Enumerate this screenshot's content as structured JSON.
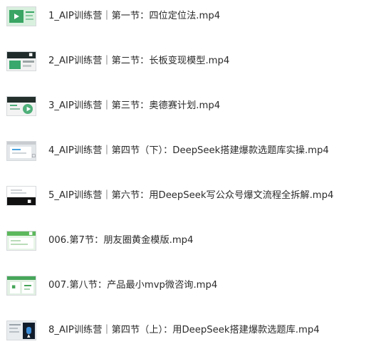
{
  "files": [
    {
      "name": "1_AIP训练营｜第一节：四位定位法.mp4",
      "thumbnail": {
        "style": "green-title-slide",
        "colors": [
          "#3aa564",
          "#ffffff",
          "#d9f0df"
        ],
        "icon": "play-icon"
      }
    },
    {
      "name": "2_AIP训练营｜第二节：长板变现模型.mp4",
      "thumbnail": {
        "style": "dark-header-slide",
        "colors": [
          "#1f2a2a",
          "#38a86c",
          "#f2f2f2"
        ],
        "icon": "slide-icon"
      }
    },
    {
      "name": "3_AIP训练营｜第三节：奥德赛计划.mp4",
      "thumbnail": {
        "style": "dark-header-slide",
        "colors": [
          "#23302c",
          "#4fb07a",
          "#f3f3f3"
        ],
        "icon": "slide-icon"
      }
    },
    {
      "name": "4_AIP训练营｜第四节（下）：DeepSeek搭建爆款选题库实操.mp4",
      "thumbnail": {
        "style": "light-screen",
        "colors": [
          "#e4e7ea",
          "#ffffff",
          "#4aa3df"
        ],
        "icon": "screen-icon"
      }
    },
    {
      "name": "5_AIP训练营｜第六节：用DeepSeek写公众号爆文流程全拆解.mp4",
      "thumbnail": {
        "style": "split-dark-screen",
        "colors": [
          "#ffffff",
          "#111111",
          "#cfd3d6"
        ],
        "icon": "screen-icon"
      }
    },
    {
      "name": "006.第7节：朋友圈黄金模版.mp4",
      "thumbnail": {
        "style": "green-sheet",
        "colors": [
          "#5cb85c",
          "#ffffff",
          "#e8f5e8"
        ],
        "icon": "sheet-icon"
      }
    },
    {
      "name": "007.第八节：产品最小mvp微咨询.mp4",
      "thumbnail": {
        "style": "green-sheet",
        "colors": [
          "#46a65a",
          "#ffffff",
          "#e2f1e4"
        ],
        "icon": "sheet-icon"
      }
    },
    {
      "name": "8_AIP训练营｜第四节（上）：用DeepSeek搭建爆款选题库.mp4",
      "thumbnail": {
        "style": "dark-photo-slide",
        "colors": [
          "#e9ecef",
          "#111c2b",
          "#3c8dd8"
        ],
        "icon": "photo-icon"
      }
    }
  ]
}
